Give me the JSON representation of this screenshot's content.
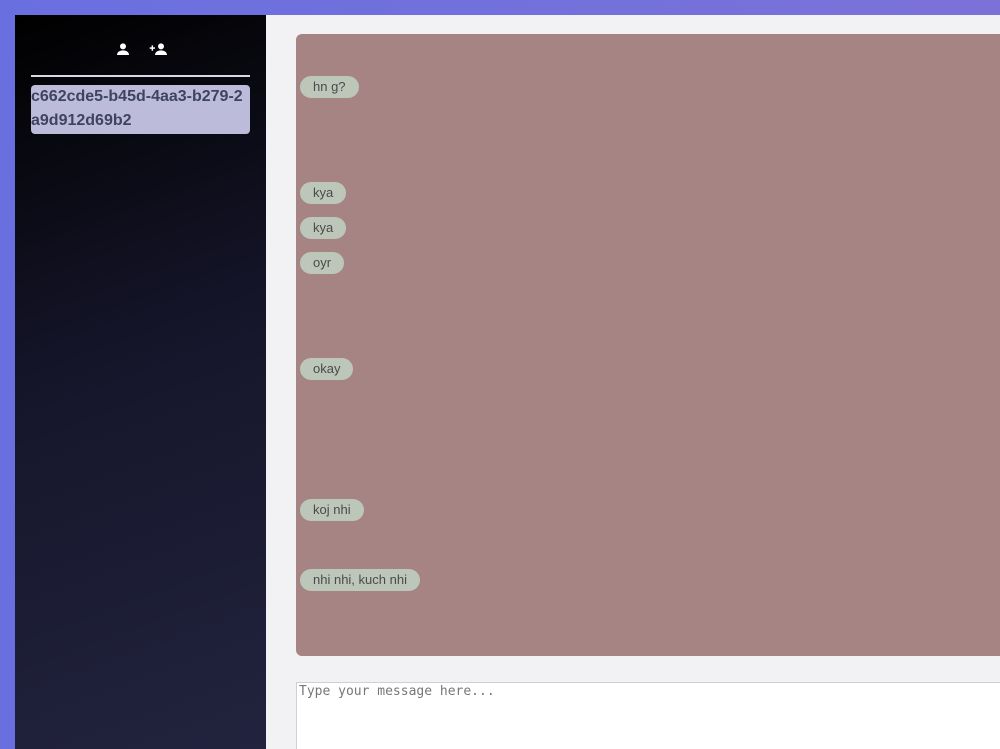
{
  "sidebar": {
    "actions": [
      {
        "icon": "person-icon"
      },
      {
        "icon": "person-add-icon"
      }
    ],
    "rooms": [
      {
        "label": "c662cde5-b45d-4aa3-b279-2a9d912d69b2",
        "selected": true
      }
    ]
  },
  "chat": {
    "messages": [
      {
        "text": "hn g?"
      },
      {
        "text": "kya"
      },
      {
        "text": "kya"
      },
      {
        "text": "oyr"
      },
      {
        "text": "okay"
      },
      {
        "text": "koj nhi"
      },
      {
        "text": "nhi nhi, kuch nhi"
      }
    ]
  },
  "composer": {
    "value": "",
    "placeholder": "Type your message here..."
  },
  "colors": {
    "messages_bg": "#a68483",
    "bubble_bg": "#bcc7b9",
    "selected_room_bg": "#bcbcda",
    "page_accent": "#6a6fe0"
  }
}
